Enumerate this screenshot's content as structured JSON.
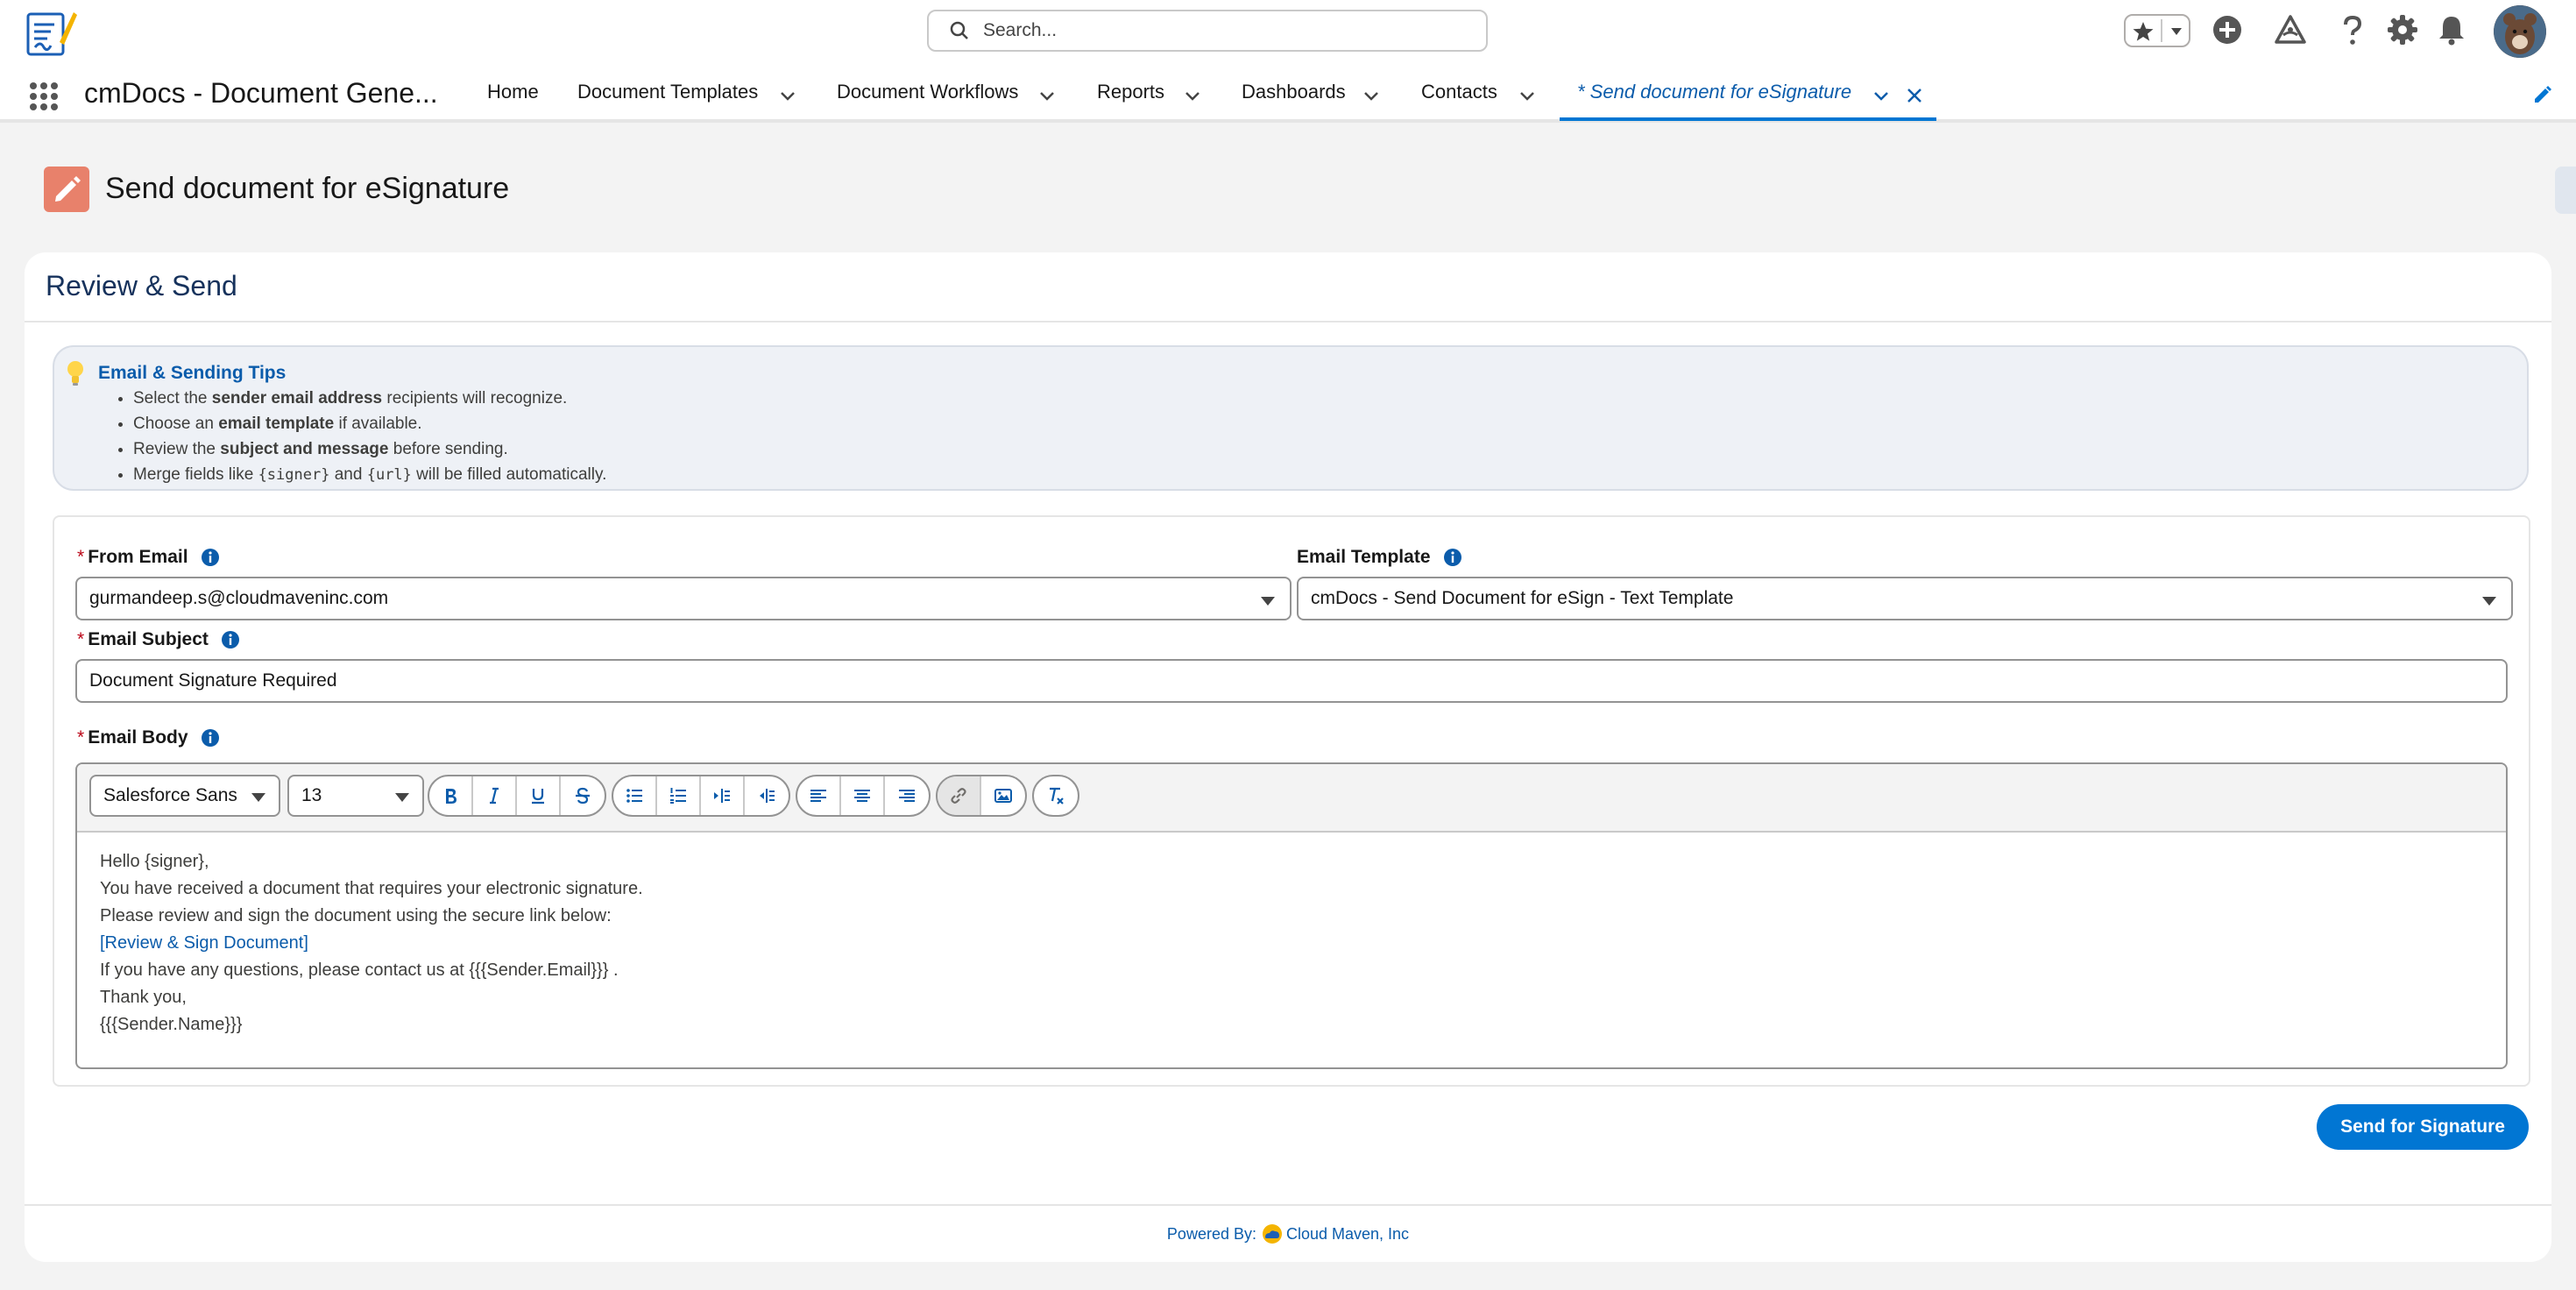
{
  "header": {
    "search_placeholder": "Search..."
  },
  "nav": {
    "app_name": "cmDocs - Document Gene...",
    "items": [
      {
        "label": "Home"
      },
      {
        "label": "Document Templates"
      },
      {
        "label": "Document Workflows"
      },
      {
        "label": "Reports"
      },
      {
        "label": "Dashboards"
      },
      {
        "label": "Contacts"
      }
    ],
    "active_tab": "* Send document for eSignature"
  },
  "page": {
    "title": "Send document for eSignature"
  },
  "card": {
    "title": "Review & Send",
    "tips": {
      "title": "Email & Sending Tips",
      "items": [
        {
          "pre": "Select the ",
          "bold": "sender email address",
          "post": " recipients will recognize."
        },
        {
          "pre": "Choose an ",
          "bold": "email template",
          "post": " if available."
        },
        {
          "pre": "Review the ",
          "bold": "subject and message",
          "post": " before sending."
        },
        {
          "pre": "Merge fields like ",
          "code1": "{signer}",
          "mid": " and ",
          "code2": "{url}",
          "post": " will be filled automatically."
        }
      ]
    },
    "form": {
      "from_email_label": "From Email",
      "from_email_value": "gurmandeep.s@cloudmaveninc.com",
      "template_label": "Email Template",
      "template_value": "cmDocs - Send Document for eSign - Text Template",
      "subject_label": "Email Subject",
      "subject_value": "Document Signature Required",
      "body_label": "Email Body",
      "font_family": "Salesforce Sans",
      "font_size": "13",
      "body_lines": [
        "Hello {signer},",
        "You have received a document that requires your electronic signature.",
        "Please review and sign the document using the secure link below:",
        "[Review & Sign Document]",
        "If you have any questions, please contact us at {{{Sender.Email}}} .",
        "Thank you,",
        "{{{Sender.Name}}}"
      ]
    },
    "send_button": "Send for Signature",
    "footer": {
      "powered_by": "Powered By:",
      "company": "Cloud Maven, Inc"
    }
  },
  "colors": {
    "brand_blue": "#0176d3",
    "link_blue": "#0b5cab",
    "page_icon": "#e8816b",
    "required": "#ba0517"
  }
}
